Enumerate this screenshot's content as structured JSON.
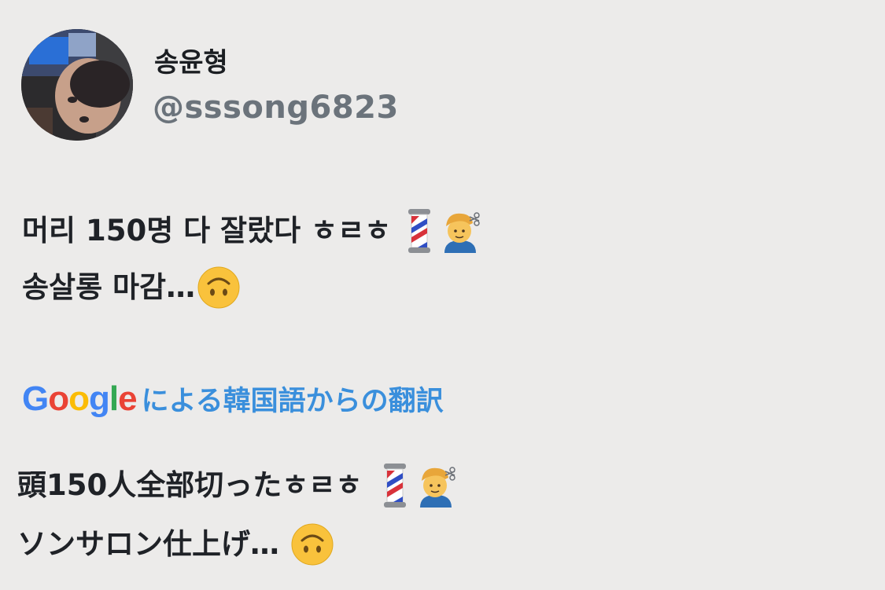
{
  "user": {
    "display_name": "송윤형",
    "handle": "@sssong6823"
  },
  "tweet": {
    "line1": "머리 150명 다 잘랐다 ㅎㄹㅎ",
    "line2": "송살롱 마감…",
    "emojis_line1": [
      "barber-pole-icon",
      "haircut-person-icon"
    ],
    "emojis_line2": [
      "upside-down-face-icon"
    ]
  },
  "translation_header": {
    "brand": "Google",
    "label": "による韓国語からの翻訳"
  },
  "translation": {
    "line1": "頭150人全部切ったㅎㄹㅎ",
    "line2": "ソンサロン仕上げ… ",
    "emojis_line1": [
      "barber-pole-icon",
      "haircut-person-icon"
    ],
    "emojis_line2": [
      "upside-down-face-icon"
    ]
  },
  "colors": {
    "background": "#ecebea",
    "translate_link": "#3a8fdc",
    "handle": "#6b737b"
  }
}
